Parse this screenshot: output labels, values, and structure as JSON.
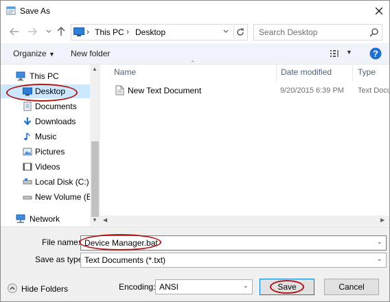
{
  "window": {
    "title": "Save As",
    "close_icon": "close-icon"
  },
  "nav": {
    "back_icon": "back-arrow-icon",
    "forward_icon": "forward-arrow-icon",
    "recent_icon": "chevron-down-icon",
    "up_icon": "up-arrow-icon",
    "address": {
      "crumbs": [
        "This PC",
        "Desktop"
      ]
    },
    "search": {
      "placeholder": "Search Desktop"
    }
  },
  "toolbar": {
    "organize": "Organize",
    "new_folder": "New folder"
  },
  "sidebar": {
    "items": [
      {
        "label": "This PC",
        "icon": "computer-icon"
      },
      {
        "label": "Desktop",
        "icon": "desktop-icon",
        "selected": true,
        "highlighted": true
      },
      {
        "label": "Documents",
        "icon": "documents-icon"
      },
      {
        "label": "Downloads",
        "icon": "downloads-icon"
      },
      {
        "label": "Music",
        "icon": "music-icon"
      },
      {
        "label": "Pictures",
        "icon": "pictures-icon"
      },
      {
        "label": "Videos",
        "icon": "videos-icon"
      },
      {
        "label": "Local Disk (C:)",
        "icon": "drive-icon"
      },
      {
        "label": "New Volume (E:)",
        "icon": "drive-icon"
      },
      {
        "label": "Network",
        "icon": "network-icon"
      }
    ]
  },
  "filelist": {
    "columns": [
      "Name",
      "Date modified",
      "Type"
    ],
    "rows": [
      {
        "name": "New Text Document",
        "date": "9/20/2015 6:39 PM",
        "type": "Text Docu"
      }
    ]
  },
  "form": {
    "filename_label": "File name:",
    "filename_value": "Device Manager.bat",
    "savetype_label": "Save as type:",
    "savetype_value": "Text Documents (*.txt)",
    "encoding_label": "Encoding:",
    "encoding_value": "ANSI"
  },
  "footer": {
    "hide_folders": "Hide Folders",
    "save": "Save",
    "cancel": "Cancel"
  },
  "colors": {
    "highlight_ellipse": "#b01818",
    "selection": "#cce8ff",
    "help_blue": "#1f6fd1"
  }
}
